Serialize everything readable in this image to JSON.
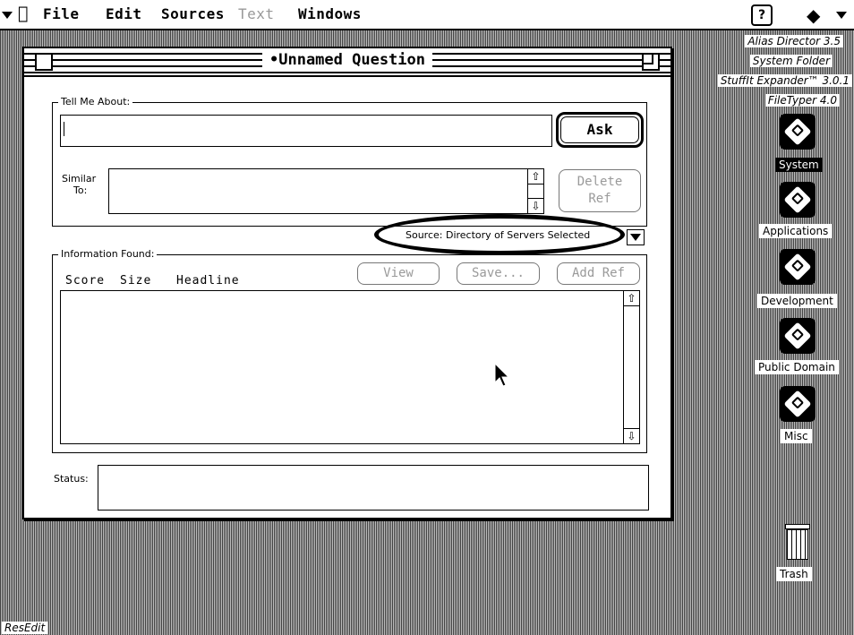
{
  "menubar": {
    "items": [
      "File",
      "Edit",
      "Sources",
      "Text",
      "Windows"
    ],
    "help": "?"
  },
  "window": {
    "title": "•Unnamed Question",
    "tell_me_label": "Tell Me About:",
    "query_value": "",
    "ask_label": "Ask",
    "similar_label_1": "Similar",
    "similar_label_2": "To:",
    "delete_label_1": "Delete",
    "delete_label_2": "Ref",
    "source_text": "Source: Directory of Servers Selected",
    "info_label": "Information Found:",
    "columns": [
      "Score",
      "Size",
      "Headline"
    ],
    "view_label": "View",
    "save_label": "Save...",
    "addref_label": "Add Ref",
    "status_label": "Status:",
    "status_value": ""
  },
  "desktop": {
    "aliases": [
      "Alias Director 3.5",
      "System Folder",
      "StuffIt Expander™ 3.0.1",
      "FileTyper 4.0"
    ],
    "icons": [
      {
        "label": "System",
        "selected": true
      },
      {
        "label": "Applications",
        "selected": false
      },
      {
        "label": "Development",
        "selected": false
      },
      {
        "label": "Public Domain",
        "selected": false
      },
      {
        "label": "Misc",
        "selected": false
      }
    ],
    "trash": "Trash",
    "resedit": "ResEdit"
  }
}
